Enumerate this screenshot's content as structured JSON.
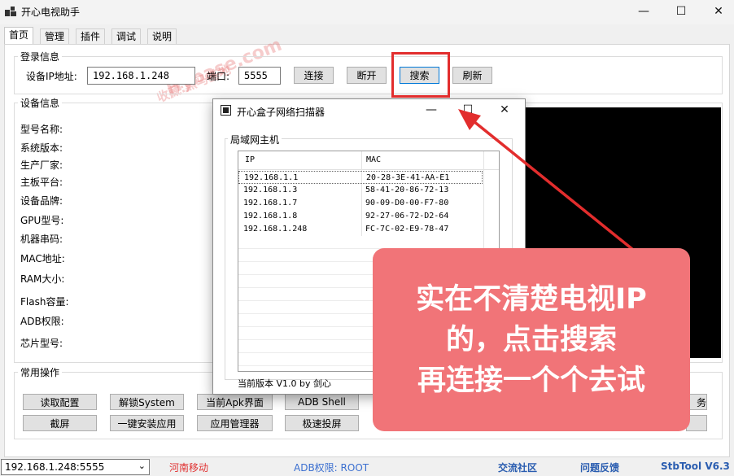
{
  "window": {
    "title": "开心电视助手",
    "minimize_glyph": "—",
    "maximize_glyph": "☐",
    "close_glyph": "✕"
  },
  "tabs": [
    {
      "label": "首页",
      "active": true
    },
    {
      "label": "管理"
    },
    {
      "label": "插件"
    },
    {
      "label": "调试"
    },
    {
      "label": "说明"
    }
  ],
  "login": {
    "group_label": "登录信息",
    "ip_label": "设备IP地址:",
    "ip_value": "192.168.1.248",
    "port_label": "端口:",
    "port_value": "5555",
    "connect": "连接",
    "disconnect": "断开",
    "search": "搜索",
    "refresh": "刷新"
  },
  "device_info": {
    "group_label": "设备信息",
    "fields": [
      "型号名称:",
      "系统版本:",
      "生产厂家:",
      "主板平台:",
      "设备品牌:",
      "GPU型号:",
      "机器串码:",
      "MAC地址:",
      "RAM大小:",
      "Flash容量:",
      "ADB权限:",
      "芯片型号:"
    ]
  },
  "common_ops": {
    "group_label": "常用操作",
    "row1": [
      "读取配置",
      "解锁System",
      "当前Apk界面",
      "ADB Shell"
    ],
    "row2": [
      "截屏",
      "一键安装应用",
      "应用管理器",
      "极速投屏"
    ],
    "partial_right_row1": "务"
  },
  "scanner": {
    "title": "开心盒子网络扫描器",
    "minimize_glyph": "—",
    "maximize_glyph": "☐",
    "close_glyph": "✕",
    "group_label": "局域网主机",
    "columns": [
      "IP",
      "MAC"
    ],
    "rows": [
      {
        "ip": "192.168.1.1",
        "mac": "20-28-3E-41-AA-E1"
      },
      {
        "ip": "192.168.1.3",
        "mac": "58-41-20-86-72-13"
      },
      {
        "ip": "192.168.1.7",
        "mac": "90-09-D0-00-F7-80"
      },
      {
        "ip": "192.168.1.8",
        "mac": "92-27-06-72-D2-64"
      },
      {
        "ip": "192.168.1.248",
        "mac": "FC-7C-02-E9-78-47"
      }
    ],
    "footer": "当前版本 V1.0  by 剑心"
  },
  "annotation": {
    "lines": [
      "实在不清楚电视IP",
      "的，点击搜索",
      "再连接一个个去试"
    ],
    "color": "#f17478",
    "box_color": "#e22d2d"
  },
  "watermark": {
    "line1": "收藏:黑马基地",
    "line2": "Hybase.com"
  },
  "statusbar": {
    "device_select": "192.168.1.248:5555",
    "operator": "河南移动",
    "adb_permission": "ADB权限: ROOT",
    "community": "交流社区",
    "feedback": "问题反馈",
    "version": "StbTool V6.3"
  },
  "colors": {
    "operator": "#e03030",
    "adb": "#3b6fd0",
    "links": "#2a5db0"
  }
}
